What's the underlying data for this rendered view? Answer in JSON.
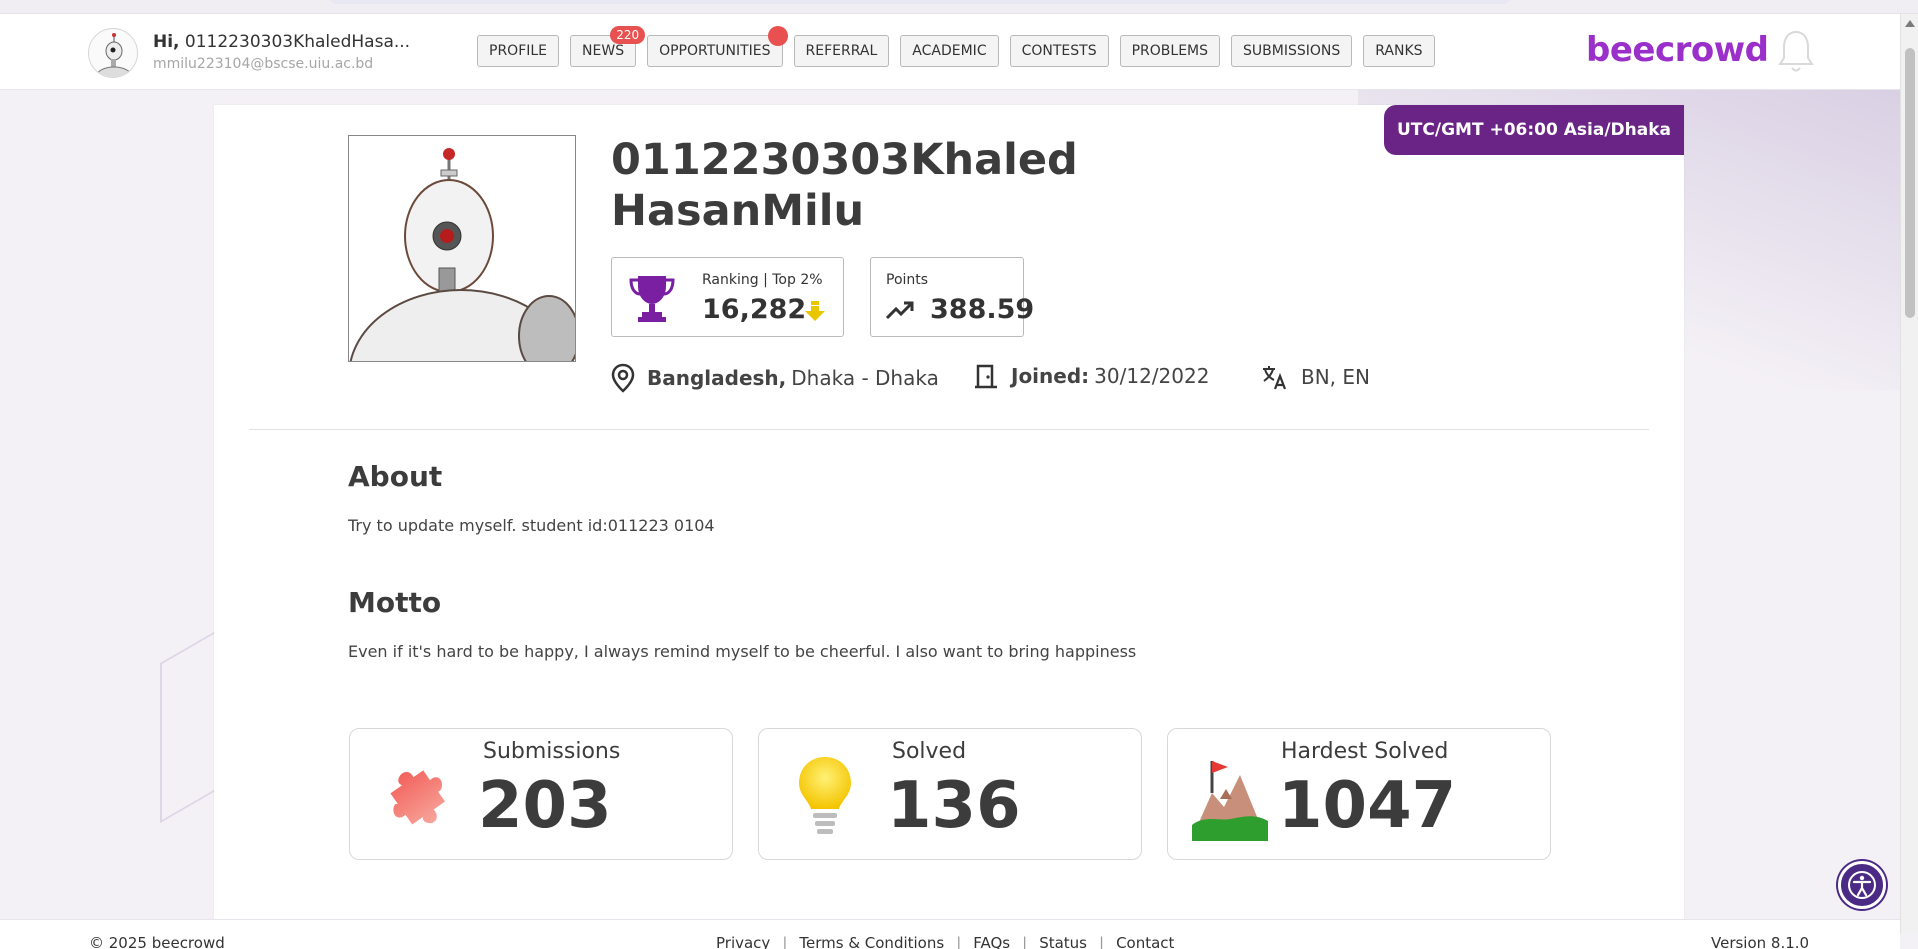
{
  "header": {
    "greeting_prefix": "Hi,",
    "username": "0112230303KhaledHasa...",
    "email": "mmilu223104@bscse.uiu.ac.bd",
    "logo": "beecrowd",
    "nav": [
      {
        "label": "PROFILE"
      },
      {
        "label": "NEWS",
        "badge": "220"
      },
      {
        "label": "OPPORTUNITIES",
        "dot": true
      },
      {
        "label": "REFERRAL"
      },
      {
        "label": "ACADEMIC"
      },
      {
        "label": "CONTESTS"
      },
      {
        "label": "PROBLEMS"
      },
      {
        "label": "SUBMISSIONS"
      },
      {
        "label": "RANKS"
      }
    ]
  },
  "profile": {
    "timezone": "UTC/GMT +06:00 Asia/Dhaka",
    "name_line1": "0112230303Khaled",
    "name_line2": "HasanMilu",
    "ranking_label": "Ranking | Top 2%",
    "ranking_value": "16,282",
    "points_label": "Points",
    "points_value": "388.59",
    "country": "Bangladesh,",
    "city": "Dhaka - Dhaka",
    "joined_label": "Joined:",
    "joined_date": "30/12/2022",
    "languages": "BN, EN"
  },
  "about": {
    "title": "About",
    "text": "Try to update myself. student id:011223 0104"
  },
  "motto": {
    "title": "Motto",
    "text": "Even if it's hard to be happy, I always remind myself to be cheerful. I also want to bring happiness"
  },
  "stats": [
    {
      "label": "Submissions",
      "value": "203"
    },
    {
      "label": "Solved",
      "value": "136"
    },
    {
      "label": "Hardest Solved",
      "value": "1047"
    }
  ],
  "footer": {
    "copyright": "© 2025 beecrowd",
    "links": [
      "Privacy",
      "Terms & Conditions",
      "FAQs",
      "Status",
      "Contact"
    ],
    "version": "Version 8.1.0"
  },
  "colors": {
    "brand": "#9b2fc9",
    "timezone_bg": "#6a2486",
    "badge": "#e8514f"
  }
}
